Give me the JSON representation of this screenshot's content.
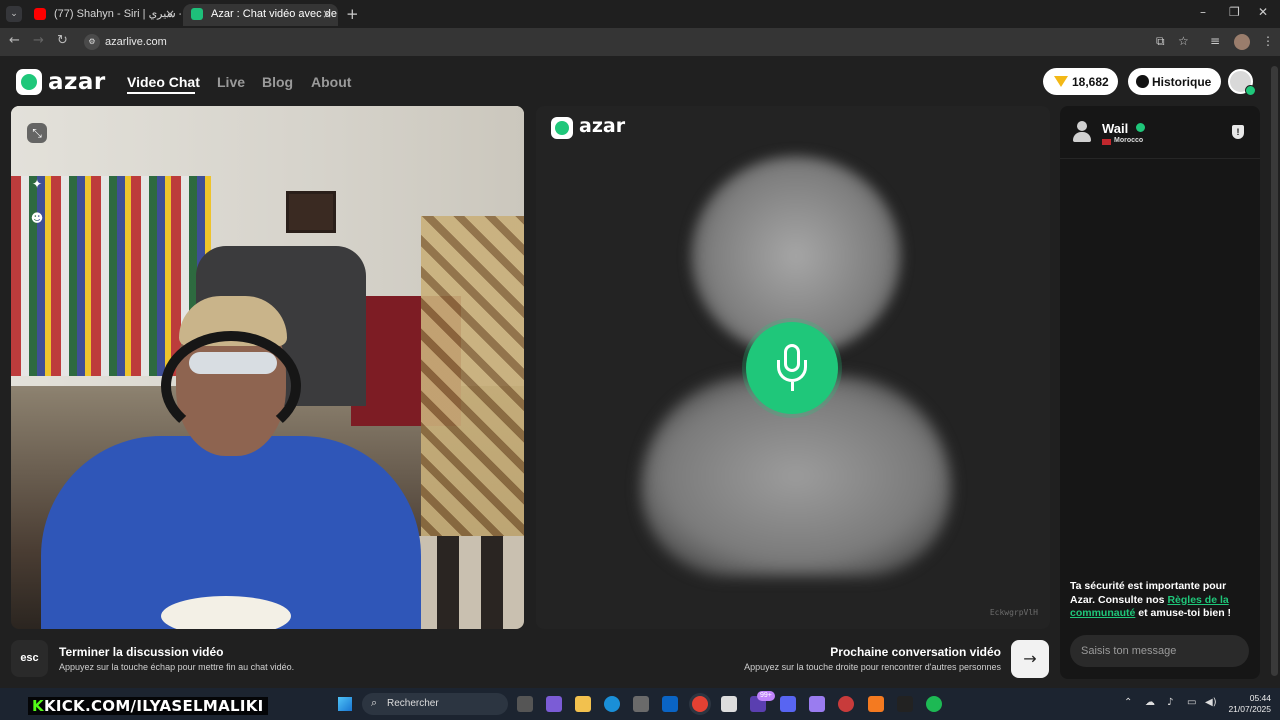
{
  "browser": {
    "tabs": [
      {
        "title": "(77) Shahyn - Siri | شاهين - سيري"
      },
      {
        "title": "Azar : Chat vidéo avec de n"
      }
    ],
    "url": "azarlive.com"
  },
  "site": {
    "logo_text": "azar",
    "nav": [
      {
        "label": "Video Chat",
        "active": true
      },
      {
        "label": "Live",
        "active": false
      },
      {
        "label": "Blog",
        "active": false
      },
      {
        "label": "About",
        "active": false
      }
    ],
    "gems": "18,682",
    "history_label": "Historique"
  },
  "remote": {
    "logo_text": "azar",
    "session_id": "EckwgrpVlH"
  },
  "chat": {
    "partner_name": "Wail",
    "partner_country": "Morocco",
    "safety_text_1": "Ta sécurité est importante pour Azar. Consulte nos ",
    "safety_link": "Règles de la communauté",
    "safety_text_2": " et amuse-toi bien !",
    "message_placeholder": "Saisis ton message"
  },
  "controls": {
    "esc_label": "esc",
    "end_title": "Terminer la discussion vidéo",
    "end_subtitle": "Appuyez sur la touche échap pour mettre fin au chat vidéo.",
    "next_title": "Prochaine conversation vidéo",
    "next_subtitle": "Appuyez sur la touche droite pour rencontrer d'autres personnes"
  },
  "taskbar": {
    "overlay_text_k": "K",
    "overlay_text": "KICK.COM/ILYASELMALIKI",
    "search_placeholder": "Rechercher",
    "badge_count": "99+",
    "time": "05:44",
    "date": "21/07/2025"
  },
  "colors": {
    "accent": "#1fc77a",
    "background": "#202020"
  }
}
